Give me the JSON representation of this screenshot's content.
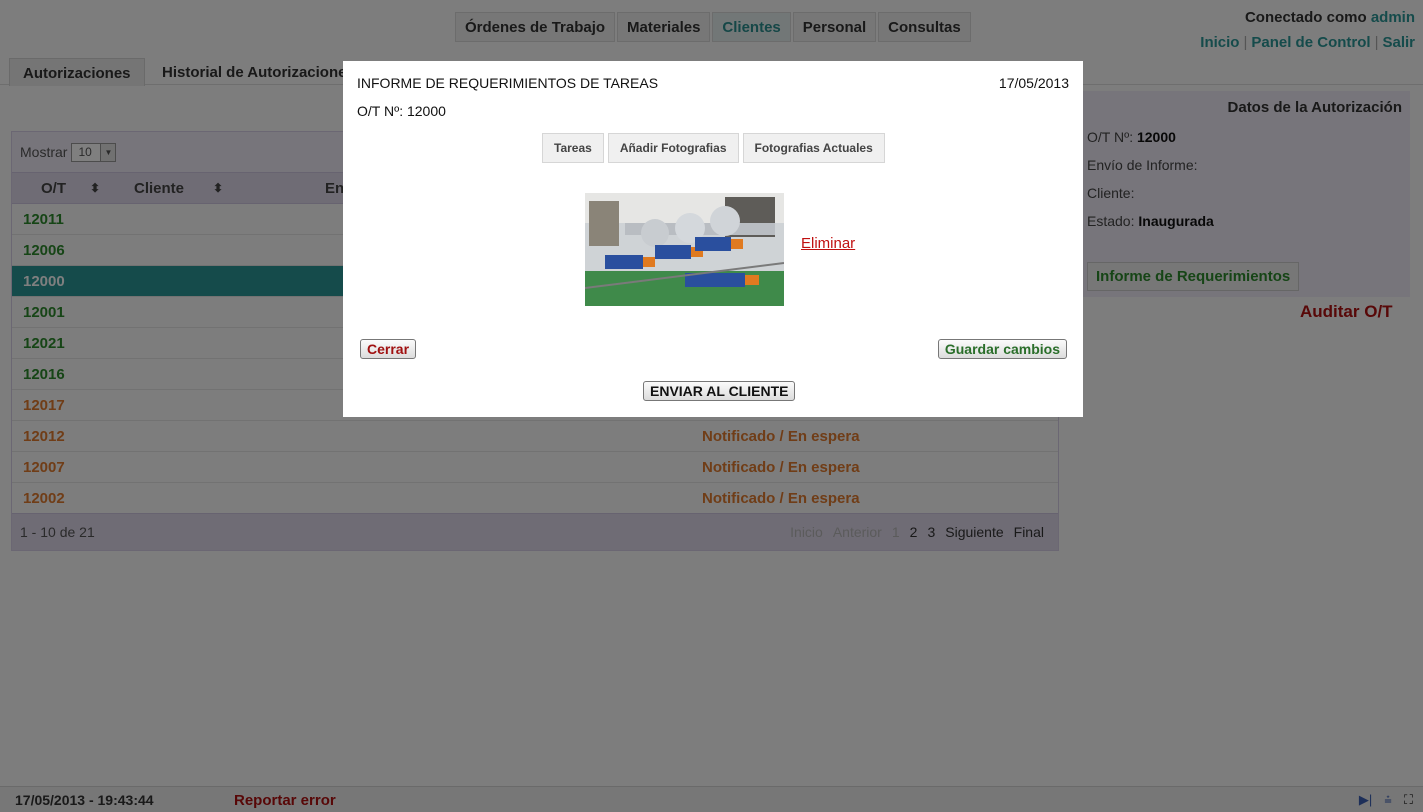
{
  "nav": {
    "tabs": [
      {
        "label": "Órdenes de Trabajo"
      },
      {
        "label": "Materiales"
      },
      {
        "label": "Clientes"
      },
      {
        "label": "Personal"
      },
      {
        "label": "Consultas"
      }
    ],
    "active_tab": "Clientes"
  },
  "user": {
    "connected_text": "Conectado como",
    "username": "admin",
    "links": [
      "Inicio",
      "Panel de Control",
      "Salir"
    ]
  },
  "subtabs": [
    "Autorizaciones",
    "Historial de Autorizaciones"
  ],
  "table": {
    "show_label": "Mostrar",
    "page_size": "10",
    "headers": [
      "O/T",
      "Cliente",
      "En"
    ],
    "rows": [
      {
        "ot": "12011",
        "status": ""
      },
      {
        "ot": "12006",
        "status": ""
      },
      {
        "ot": "12000",
        "status": ""
      },
      {
        "ot": "12001",
        "status": ""
      },
      {
        "ot": "12021",
        "status": ""
      },
      {
        "ot": "12016",
        "status": ""
      },
      {
        "ot": "12017",
        "status": ""
      },
      {
        "ot": "12012",
        "status": "Notificado / En espera"
      },
      {
        "ot": "12007",
        "status": "Notificado / En espera"
      },
      {
        "ot": "12002",
        "status": "Notificado / En espera"
      }
    ],
    "footer_count": "1 - 10 de 21",
    "pager": [
      "Inicio",
      "Anterior",
      "1",
      "2",
      "3",
      "Siguiente",
      "Final"
    ]
  },
  "details": {
    "title": "Datos de la Autorización",
    "ot_label": "O/T Nº:",
    "ot_value": "12000",
    "envio_label": "Envío de Informe:",
    "cliente_label": "Cliente:",
    "estado_label": "Estado:",
    "estado_value": "Inaugurada",
    "report_button": "Informe de Requerimientos",
    "audit_link": "Auditar O/T"
  },
  "modal": {
    "title": "INFORME DE REQUERIMIENTOS DE TAREAS",
    "date": "17/05/2013",
    "ot_line": "O/T Nº: 12000",
    "tabs": [
      "Tareas",
      "Añadir Fotografias",
      "Fotografias Actuales"
    ],
    "delete_link": "Eliminar",
    "close_button": "Cerrar",
    "save_button": "Guardar cambios",
    "send_button": "ENVIAR AL CLIENTE"
  },
  "status": {
    "datetime": "17/05/2013 - 19:43:44",
    "report_error": "Reportar error"
  },
  "colors": {
    "accent": "#2b9696",
    "green_text": "#2d8a2d",
    "orange_text": "#e07a2e",
    "danger": "#b01010"
  }
}
